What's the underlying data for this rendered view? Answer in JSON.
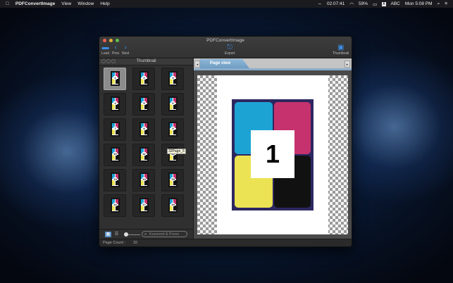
{
  "menubar": {
    "apple": "",
    "app_name": "PDFConvertImage",
    "menus": [
      "View",
      "Window",
      "Help"
    ],
    "time_small": "02:07:41",
    "battery": "59%",
    "input_source": "ABC",
    "clock": "Mon 5:08 PM"
  },
  "window": {
    "title": "PDFConvertImage",
    "toolbar": {
      "load": "Load",
      "prev": "Prev",
      "next": "Next",
      "export": "Export",
      "thumbnail": "Thumbnail"
    },
    "traffic_lights": [
      "#ec5f57",
      "#e0b33b",
      "#5fbf4b"
    ]
  },
  "left_panel": {
    "header": "Thumbnail",
    "thumbnails": [
      "1",
      "2",
      "3",
      "4",
      "5",
      "6",
      "7",
      "8",
      "9",
      "10",
      "11",
      "12",
      "13",
      "14",
      "15",
      "16",
      "17",
      "18"
    ],
    "selected": "1",
    "tooltip": "32Page_6",
    "search_placeholder": "Keyword & Press"
  },
  "right_panel": {
    "tab_label": "Page view",
    "page_number": "1",
    "quad_colors": [
      "#1da3d3",
      "#c6326d",
      "#ece354",
      "#111111"
    ]
  },
  "status": {
    "label": "Page Count :",
    "value": "32"
  }
}
